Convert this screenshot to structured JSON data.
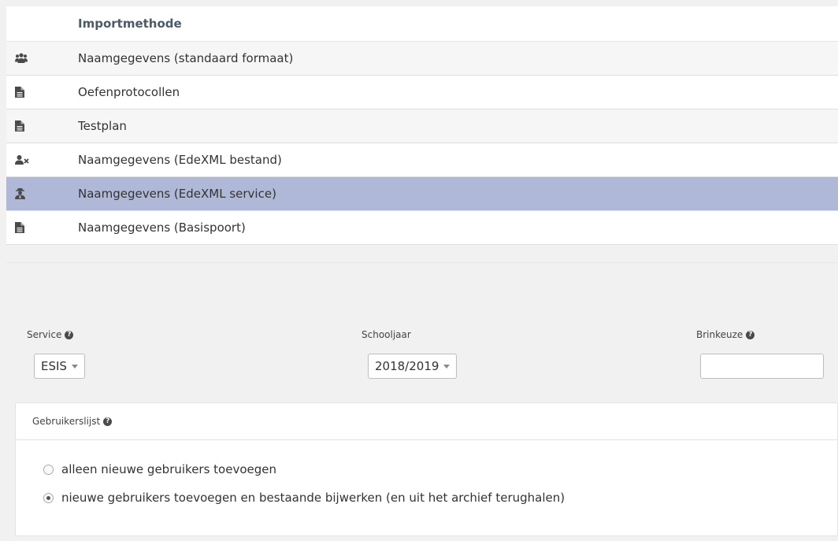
{
  "table": {
    "header": "Importmethode",
    "rows": [
      {
        "icon": "users-icon",
        "label": "Naamgegevens (standaard formaat)"
      },
      {
        "icon": "file-text-icon",
        "label": "Oefenprotocollen"
      },
      {
        "icon": "file-text-icon",
        "label": "Testplan"
      },
      {
        "icon": "user-times-icon",
        "label": "Naamgegevens (EdeXML bestand)"
      },
      {
        "icon": "user-secret-icon",
        "label": "Naamgegevens (EdeXML service)",
        "selected": true
      },
      {
        "icon": "file-text-icon",
        "label": "Naamgegevens (Basispoort)"
      }
    ]
  },
  "form": {
    "service_label": "Service",
    "service_value": "ESIS",
    "schooljaar_label": "Schooljaar",
    "schooljaar_value": "2018/2019",
    "brinkeuze_label": "Brinkeuze",
    "brinkeuze_value": "",
    "help_glyph": "?"
  },
  "gebruikerslijst": {
    "title": "Gebruikerslijst",
    "options": [
      {
        "label": "alleen nieuwe gebruikers toevoegen",
        "checked": false
      },
      {
        "label": "nieuwe gebruikers toevoegen en bestaande bijwerken (en uit het archief terughalen)",
        "checked": true
      }
    ]
  },
  "colors": {
    "selected_row": "#b0b8d8",
    "icon": "#4a4a4a",
    "header_text": "#4a5a66"
  }
}
